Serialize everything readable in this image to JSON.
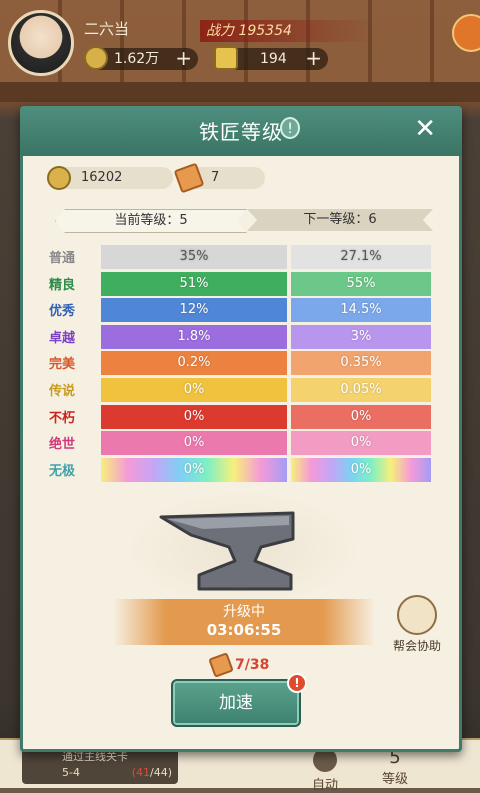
{
  "hud": {
    "player_name": "二六当",
    "power_label": "战力",
    "power_value": "195354",
    "coins": "1.62万",
    "ingots": "194",
    "plus": "+"
  },
  "modal": {
    "title": "铁匠等级",
    "info_symbol": "!",
    "close_symbol": "✕",
    "coin_amount": "16202",
    "scroll_amount": "7",
    "current_level_text": "当前等级：5",
    "next_level_text": "下一等级：6",
    "rows": [
      {
        "label": "普通",
        "label_color": "#8a8a8a",
        "current": "35%",
        "next": "27.1%",
        "cur_bg": "#d7d7d7",
        "next_bg": "#e2e2e2",
        "text_color": "#555"
      },
      {
        "label": "精良",
        "label_color": "#2e8b4a",
        "current": "51%",
        "next": "55%",
        "cur_bg": "#3fae5e",
        "next_bg": "#6bc888",
        "text_color": "#fff"
      },
      {
        "label": "优秀",
        "label_color": "#2f62b8",
        "current": "12%",
        "next": "14.5%",
        "cur_bg": "#4f86d6",
        "next_bg": "#7aa8ea",
        "text_color": "#fff"
      },
      {
        "label": "卓越",
        "label_color": "#7b42c8",
        "current": "1.8%",
        "next": "3%",
        "cur_bg": "#9b6ddf",
        "next_bg": "#b996ee",
        "text_color": "#fff"
      },
      {
        "label": "完美",
        "label_color": "#d5562a",
        "current": "0.2%",
        "next": "0.35%",
        "cur_bg": "#ec8240",
        "next_bg": "#f2a46e",
        "text_color": "#fff"
      },
      {
        "label": "传说",
        "label_color": "#c99b1a",
        "current": "0%",
        "next": "0.05%",
        "cur_bg": "#f0c23e",
        "next_bg": "#f4d36e",
        "text_color": "#fff"
      },
      {
        "label": "不朽",
        "label_color": "#c8231d",
        "current": "0%",
        "next": "0%",
        "cur_bg": "#dc3a2e",
        "next_bg": "#ea6e62",
        "text_color": "#fff"
      },
      {
        "label": "绝世",
        "label_color": "#d0397c",
        "current": "0%",
        "next": "0%",
        "cur_bg": "#ec79ad",
        "next_bg": "#f29cc3",
        "text_color": "#fff"
      },
      {
        "label": "无极",
        "label_color": "#3fa0a8",
        "current": "0%",
        "next": "0%",
        "cur_bg": "rainbow",
        "next_bg": "rainbow",
        "text_color": "#fff"
      }
    ],
    "upgrading_label": "升级中",
    "timer": "03:06:55",
    "guild_help_label": "帮会协助",
    "scroll_progress": "7/38",
    "speed_button": "加速"
  },
  "bottom": {
    "task_title": "通过主线关卡",
    "task_stage": "5-4",
    "task_progress_done": "(41",
    "task_progress_total": "/44)",
    "auto_label": "自动",
    "level_num": "5",
    "level_label": "等级"
  }
}
